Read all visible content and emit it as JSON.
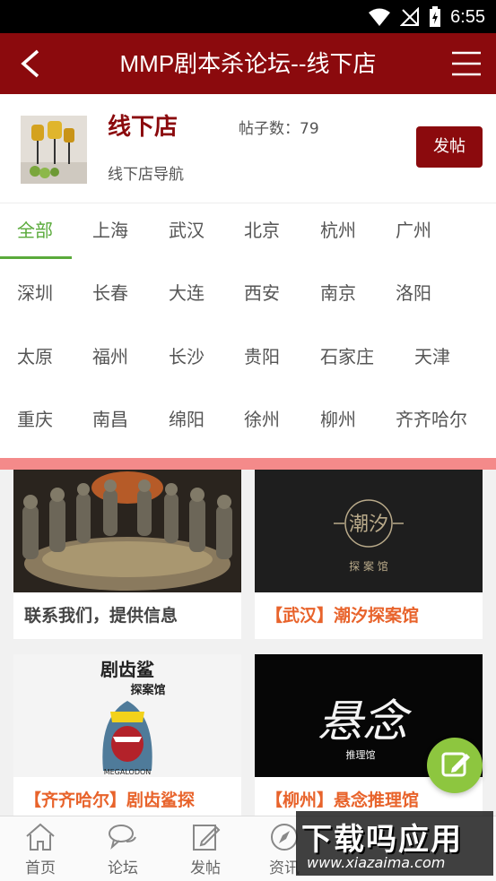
{
  "status_bar": {
    "time": "6:55"
  },
  "header": {
    "title": "MMP剧本杀论坛--线下店"
  },
  "forum": {
    "name": "线下店",
    "post_count": "帖子数：79",
    "description": "线下店导航",
    "post_button": "发帖"
  },
  "cities": [
    "全部",
    "上海",
    "武汉",
    "北京",
    "杭州",
    "广州",
    "深圳",
    "长春",
    "大连",
    "西安",
    "南京",
    "洛阳",
    "太原",
    "福州",
    "长沙",
    "贵阳",
    "石家庄",
    "天津",
    "重庆",
    "南昌",
    "绵阳",
    "徐州",
    "柳州",
    "齐齐哈尔"
  ],
  "active_city": "全部",
  "cards": [
    {
      "caption": "联系我们，提供信息"
    },
    {
      "caption": "【武汉】潮汐探案馆",
      "logo_text": "潮汐",
      "logo_sub": "探 案 馆"
    },
    {
      "caption": "【齐齐哈尔】剧齿鲨探",
      "logo_text": "剧齿鲨",
      "logo_sub": "MEGALODON",
      "logo_tag": "探案馆"
    },
    {
      "caption": "【柳州】悬念推理馆",
      "logo_text": "悬念",
      "logo_sub": "推理馆"
    }
  ],
  "bottom_nav": [
    {
      "label": "首页",
      "icon": "home-icon"
    },
    {
      "label": "论坛",
      "icon": "chat-icon"
    },
    {
      "label": "发帖",
      "icon": "edit-icon"
    },
    {
      "label": "资讯",
      "icon": "compass-icon"
    }
  ],
  "watermark": {
    "title": "下载吗应用",
    "url": "www.xiazaima.com"
  },
  "colors": {
    "brand": "#8b0a0d",
    "accent": "#5aaa3b",
    "orange": "#e8632b",
    "divider": "#f48a8a"
  }
}
